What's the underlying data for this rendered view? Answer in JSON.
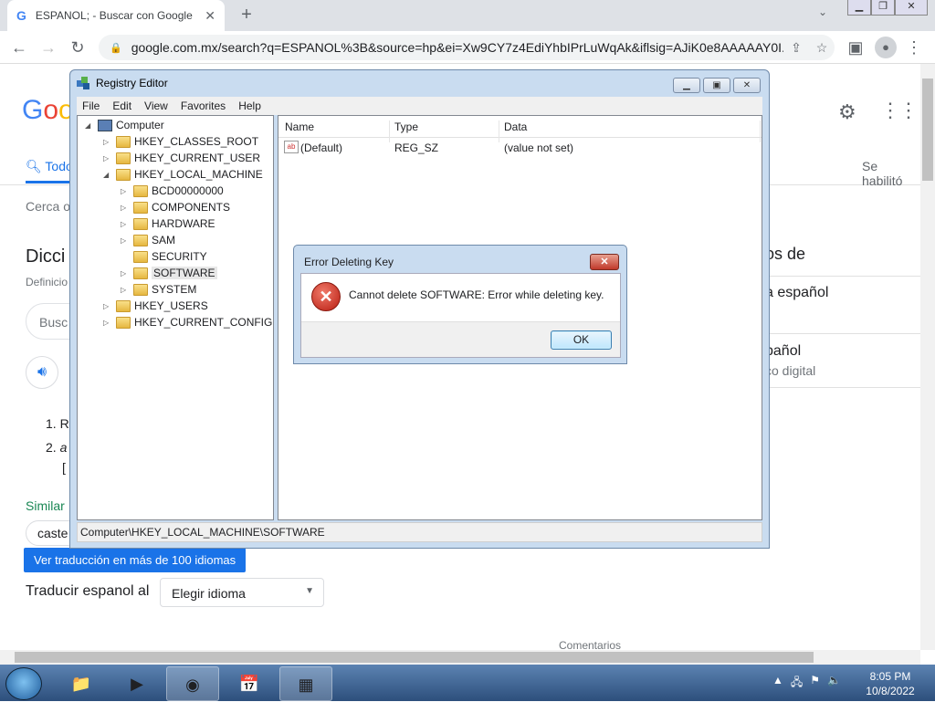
{
  "browser": {
    "tab_title": "ESPANOL; - Buscar con Google",
    "tab_favicon": "G",
    "url": "google.com.mx/search?q=ESPANOL%3B&source=hp&ei=Xw9CY7z4EdiYhbIPrLuWqAk&iflsig=AJiK0e8AAAAAY0I..."
  },
  "google": {
    "logo": "Goo",
    "tab_all": "Todo",
    "settings_note": "Se habilitó",
    "near_text": "Cerca o",
    "dictionary_title": "Dicci",
    "definitions_label": "Definicio",
    "search_placeholder": "Busc",
    "list_item_1_num": "1.",
    "list_item_1": "R",
    "list_item_2_num": "2.",
    "list_item_2": "a",
    "list_item_3": "[",
    "similar_label": "Similar",
    "similar_chip": "caste",
    "translate_button": "Ver traducción en más de 100 idiomas",
    "translate_label": "Traducir espanol al",
    "translate_select": "Elegir idioma",
    "right_heading": "os de",
    "right_item_1": "a español",
    "right_item_2": "pañol",
    "right_item_2_sub": "co digital",
    "feedback": "Comentarios"
  },
  "regedit": {
    "title": "Registry Editor",
    "menu": [
      "File",
      "Edit",
      "View",
      "Favorites",
      "Help"
    ],
    "tree": {
      "root": "Computer",
      "hives": [
        "HKEY_CLASSES_ROOT",
        "HKEY_CURRENT_USER",
        "HKEY_LOCAL_MACHINE"
      ],
      "hklm_children": [
        "BCD00000000",
        "COMPONENTS",
        "HARDWARE",
        "SAM",
        "SECURITY",
        "SOFTWARE",
        "SYSTEM"
      ],
      "more_hives": [
        "HKEY_USERS",
        "HKEY_CURRENT_CONFIG"
      ]
    },
    "columns": [
      "Name",
      "Type",
      "Data"
    ],
    "rows": [
      {
        "name": "(Default)",
        "type": "REG_SZ",
        "data": "(value not set)"
      }
    ],
    "status": "Computer\\HKEY_LOCAL_MACHINE\\SOFTWARE"
  },
  "error_dialog": {
    "title": "Error Deleting Key",
    "message": "Cannot delete SOFTWARE:  Error while deleting key.",
    "ok": "OK"
  },
  "taskbar": {
    "time": "8:05 PM",
    "date": "10/8/2022"
  }
}
